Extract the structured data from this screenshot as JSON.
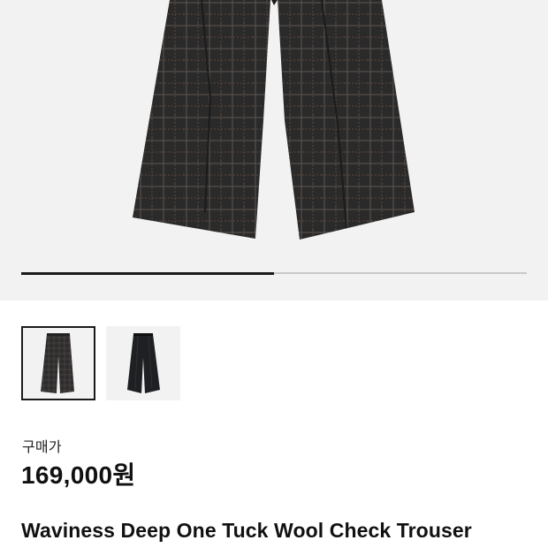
{
  "gallery": {
    "progress_fraction": 0.5,
    "thumbnails": [
      {
        "icon": "check-wide-trouser-image",
        "selected": true
      },
      {
        "icon": "dark-wide-trouser-image",
        "selected": false
      }
    ]
  },
  "product": {
    "price_label": "구매가",
    "price": "169,000원",
    "title": "Waviness Deep One Tuck Wool Check Trouser"
  },
  "colors": {
    "background": "#ffffff",
    "gallery_bg": "#f2f2f2",
    "fabric": "#2b2a2a",
    "accent": "#1a1a1a"
  }
}
